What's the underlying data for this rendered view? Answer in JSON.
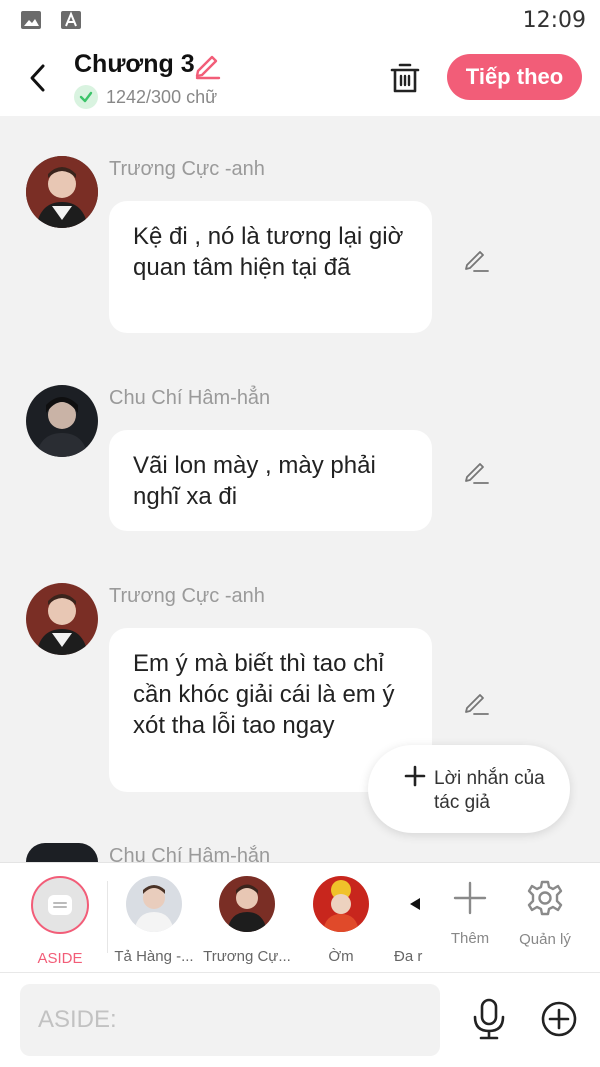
{
  "status_bar": {
    "time": "12:09",
    "icons": [
      "image-icon",
      "font-a-icon"
    ]
  },
  "header": {
    "back_icon": "chevron-left-icon",
    "title": "Chương 3",
    "word_count": "1242/300 chữ",
    "next_label": "Tiếp theo",
    "colors": {
      "accent": "#f25d78",
      "check": "#3cc46a"
    }
  },
  "messages": [
    {
      "sender": "Trương Cực -anh",
      "text": "Kệ đi , nó là tương lại giờ quan tâm hiện tại đã"
    },
    {
      "sender": "Chu Chí Hâm-hẳn",
      "text": "Vãi lon mày , mày phải nghĩ xa đi"
    },
    {
      "sender": "Trương Cực -anh",
      "text": "Em ý mà biết thì tao chỉ cần khóc giải cái là em ý xót tha lỗi tao ngay"
    },
    {
      "sender": "Chu Chí Hâm-hẳn",
      "text": ""
    }
  ],
  "author_note": {
    "label": "Lời nhắn của tác giả"
  },
  "characters": [
    {
      "label": "ASIDE"
    },
    {
      "label": "Tả Hàng -..."
    },
    {
      "label": "Trương Cự..."
    },
    {
      "label": "Ờm"
    },
    {
      "label": "Đa r"
    }
  ],
  "tools": [
    {
      "label": "Thêm"
    },
    {
      "label": "Quản lý"
    }
  ],
  "input": {
    "placeholder": "ASIDE:"
  }
}
